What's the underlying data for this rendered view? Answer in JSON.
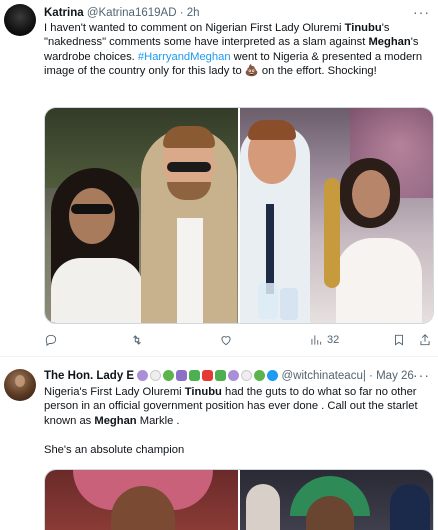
{
  "tweets": [
    {
      "name": "Katrina",
      "handle": "@Katrina1619AD",
      "dot": "·",
      "time": "2h",
      "more": "···",
      "text": {
        "p1": "I haven't wanted to comment on Nigerian First Lady Oluremi ",
        "tinubu": "Tinubu",
        "p2": "'s \"nakedness\" comments some have interpreted as a slam against ",
        "meghan": "Meghan",
        "p3": "'s wardrobe choices. ",
        "hashtag": "#HarryandMeghan",
        "p4": " went to Nigeria & presented a modern image of the country only for this lady to ",
        "emoji": "💩",
        "p5": " on the effort. Shocking!"
      },
      "actions": {
        "reply_count": "",
        "retweet_count": "",
        "like_count": "",
        "views_count": "32"
      }
    },
    {
      "name": "The Hon. Lady E",
      "handle": "@witchinateacu|",
      "dot": "·",
      "time": "May 26",
      "more": "···",
      "text": {
        "p1": "Nigeria's First Lady Oluremi ",
        "tinubu": "Tinubu",
        "p2": " had the guts to do what so far no other person in an official government position has ever done . Call out the starlet known as ",
        "meghan": "Meghan",
        "p3": " Markle .",
        "p4": "She's an absolute champion"
      }
    }
  ],
  "colors": {
    "accent": "#1d9bf0",
    "text": "#0f1419",
    "secondary": "#536471"
  }
}
